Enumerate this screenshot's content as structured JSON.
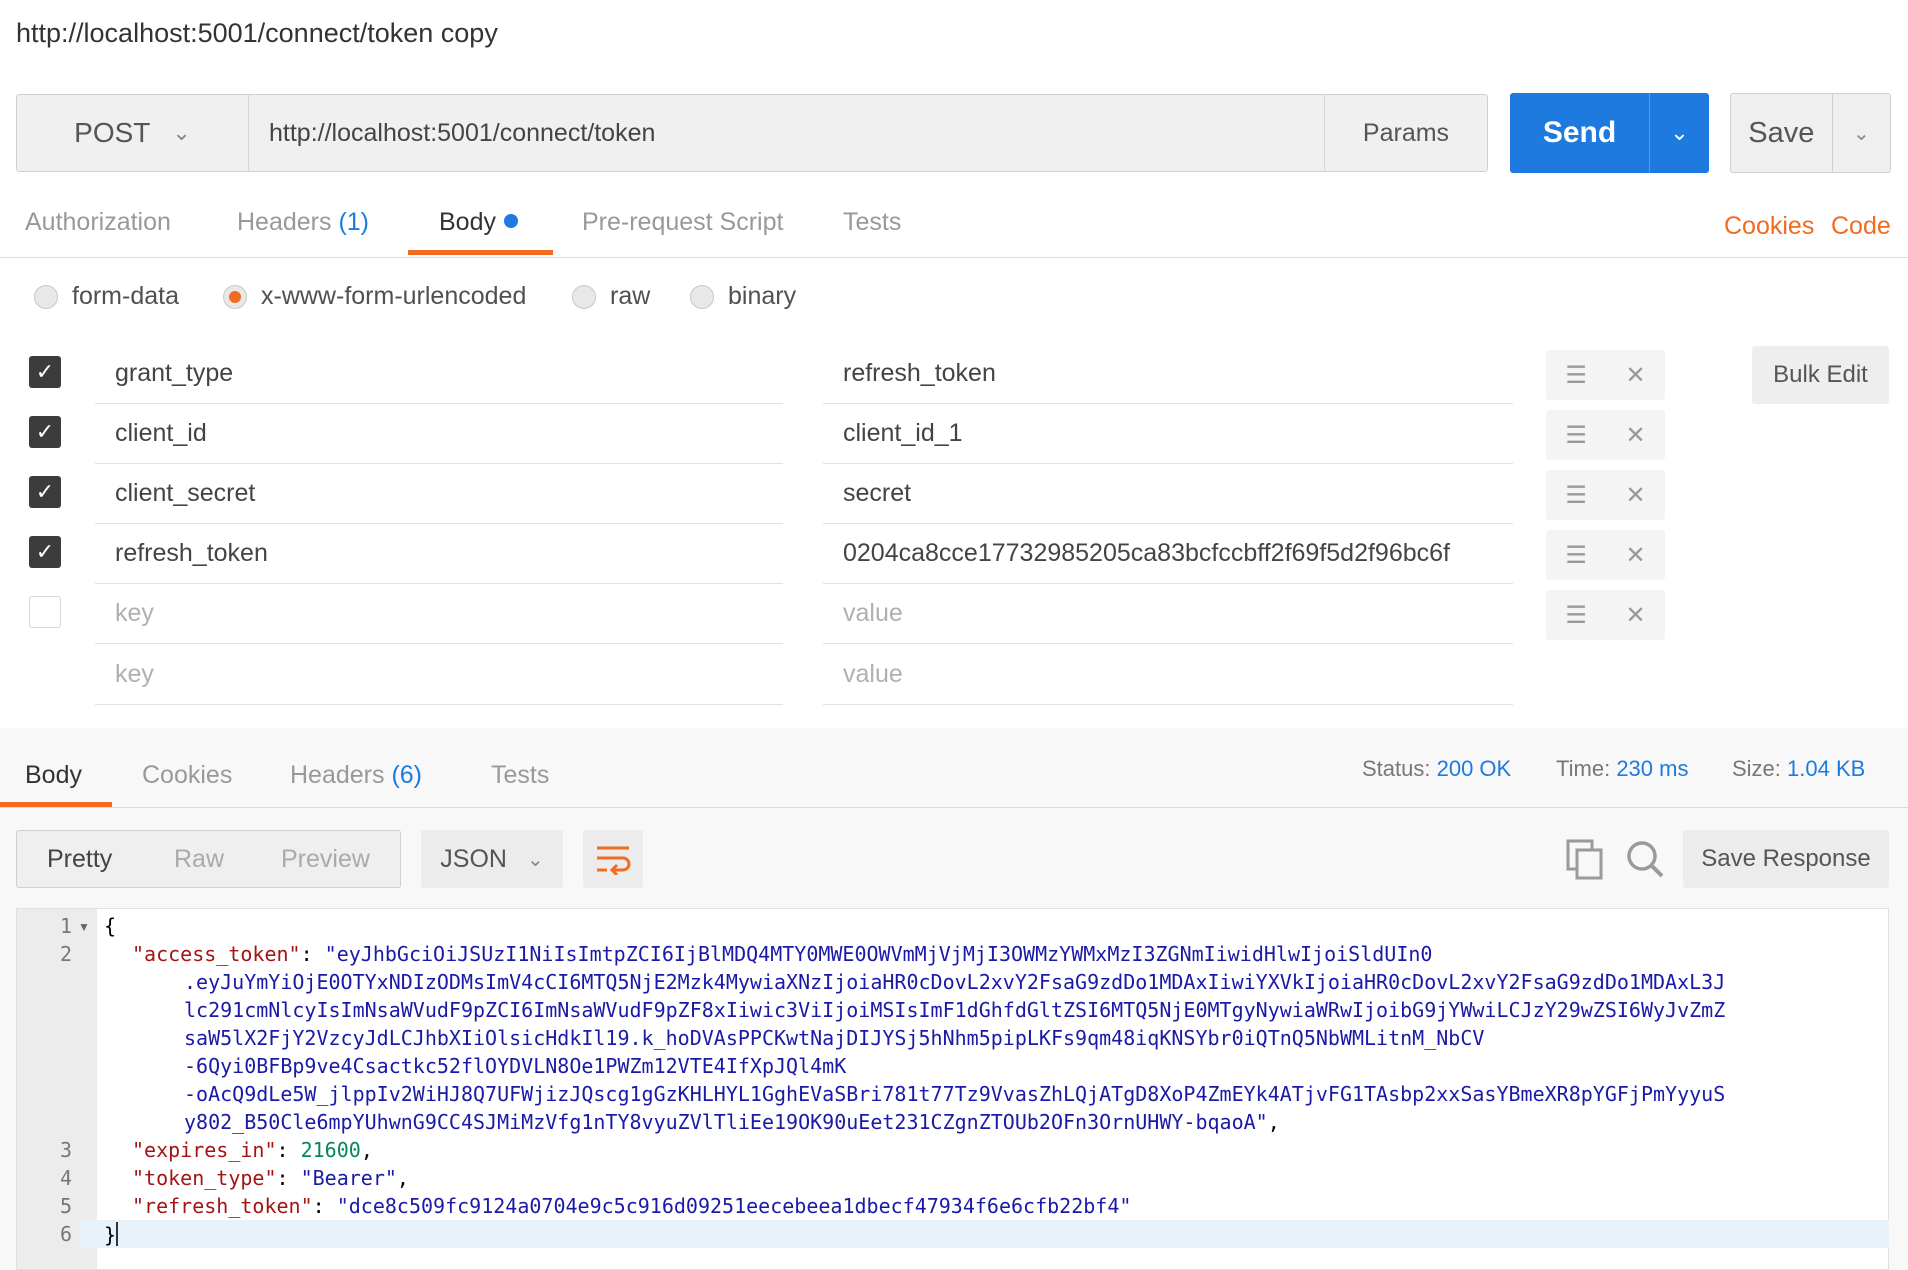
{
  "request": {
    "title": "http://localhost:5001/connect/token copy",
    "method": "POST",
    "url": "http://localhost:5001/connect/token",
    "params_label": "Params",
    "send_label": "Send",
    "save_label": "Save"
  },
  "req_tabs": {
    "authorization": "Authorization",
    "headers": "Headers",
    "headers_count": "(1)",
    "body": "Body",
    "prerequest": "Pre-request Script",
    "tests": "Tests",
    "cookies": "Cookies",
    "code": "Code"
  },
  "body_modes": {
    "form_data": "form-data",
    "urlencoded": "x-www-form-urlencoded",
    "raw": "raw",
    "binary": "binary",
    "selected": "x-www-form-urlencoded"
  },
  "params": [
    {
      "checked": true,
      "key": "grant_type",
      "value": "refresh_token"
    },
    {
      "checked": true,
      "key": "client_id",
      "value": "client_id_1"
    },
    {
      "checked": true,
      "key": "client_secret",
      "value": "secret"
    },
    {
      "checked": true,
      "key": "refresh_token",
      "value": "0204ca8cce17732985205ca83bcfccbff2f69f5d2f96bc6f"
    }
  ],
  "placeholders": {
    "key": "key",
    "value": "value"
  },
  "bulk_edit_label": "Bulk Edit",
  "response": {
    "tabs": {
      "body": "Body",
      "cookies": "Cookies",
      "headers": "Headers",
      "headers_count": "(6)",
      "tests": "Tests"
    },
    "status_label": "Status:",
    "status_value": "200 OK",
    "time_label": "Time:",
    "time_value": "230 ms",
    "size_label": "Size:",
    "size_value": "1.04 KB",
    "views": {
      "pretty": "Pretty",
      "raw": "Raw",
      "preview": "Preview"
    },
    "format": "JSON",
    "save_response_label": "Save Response",
    "code_lines": {
      "l1": "{",
      "k_access": "\"access_token\"",
      "access_1": "\"eyJhbGciOiJSUzI1NiIsImtpZCI6IjBlMDQ4MTY0MWE0OWVmMjVjMjI3OWMzYWMxMzI3ZGNmIiwidHlwIjoiSldUIn0",
      "access_2": ".eyJuYmYiOjE0OTYxNDIzODMsImV4cCI6MTQ5NjE2Mzk4MywiaXNzIjoiaHR0cDovL2xvY2FsaG9zdDo1MDAxIiwiYXVkIjoiaHR0cDovL2xvY2FsaG9zdDo1MDAxL3J",
      "access_3": "lc291cmNlcyIsImNsaWVudF9pZCI6ImNsaWVudF9pZF8xIiwic3ViIjoiMSIsImF1dGhfdGltZSI6MTQ5NjE0MTgyNywiaWRwIjoibG9jYWwiLCJzY29wZSI6WyJvZmZ",
      "access_4": "saW5lX2FjY2VzcyJdLCJhbXIiOlsicHdkIl19.k_hoDVAsPPCKwtNajDIJYSj5hNhm5pipLKFs9qm48iqKNSYbr0iQTnQ5NbWMLitnM_NbCV",
      "access_5": "-6Qyi0BFBp9ve4Csactkc52flOYDVLN8Oe1PWZm12VTE4IfXpJQl4mK",
      "access_6": "-oAcQ9dLe5W_jlppIv2WiHJ8Q7UFWjizJQscg1gGzKHLHYL1GghEVaSBri781t77Tz9VvasZhLQjATgD8XoP4ZmEYk4ATjvFG1TAsbp2xxSasYBmeXR8pYGFjPmYyyuS",
      "access_7": "y802_B50Cle6mpYUhwnG9CC4SJMiMzVfg1nTY8vyuZVlTliEe19OK90uEet231CZgnZTOUb2OFn3OrnUHWY-bqaoA\"",
      "k_expires": "\"expires_in\"",
      "v_expires": "21600",
      "k_type": "\"token_type\"",
      "v_type": "\"Bearer\"",
      "k_refresh": "\"refresh_token\"",
      "v_refresh": "\"dce8c509fc9124a0704e9c5c916d09251eecebeea1dbecf47934f6e6cfb22bf4\"",
      "l6": "}"
    },
    "line_numbers": [
      "1",
      "2",
      "3",
      "4",
      "5",
      "6"
    ]
  }
}
